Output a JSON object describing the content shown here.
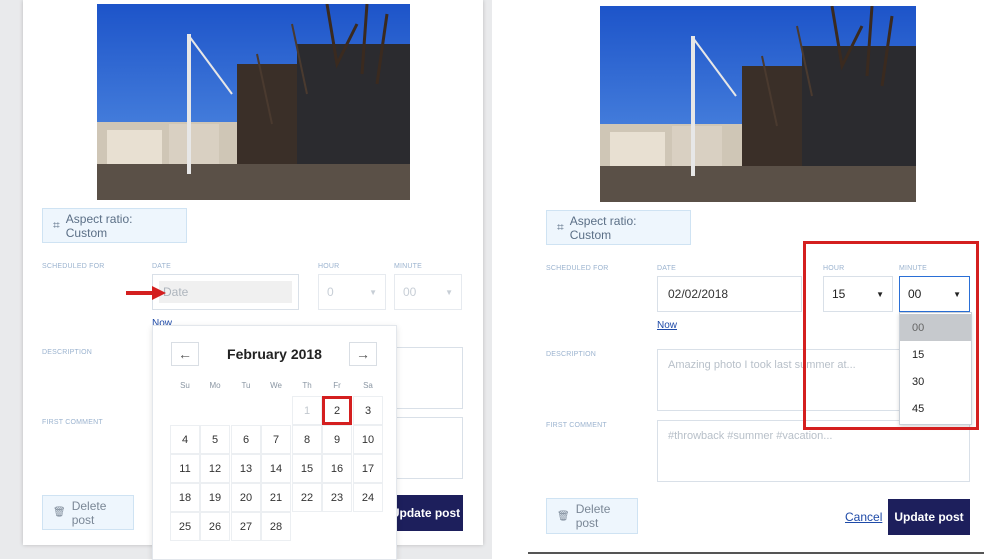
{
  "left": {
    "aspect_label": "Aspect ratio: Custom",
    "scheduled_for": "SCHEDULED FOR",
    "date_label": "DATE",
    "hour_label": "HOUR",
    "minute_label": "MINUTE",
    "date_placeholder": "Date",
    "hour_value": "0",
    "minute_value": "00",
    "now_link": "Now",
    "description_label": "DESCRIPTION",
    "first_comment_label": "FIRST COMMENT",
    "delete_label": "Delete post",
    "update_label": "Update post",
    "calendar": {
      "month": "February 2018",
      "prev": "←",
      "next": "→",
      "weekdays": [
        "Su",
        "Mo",
        "Tu",
        "We",
        "Th",
        "Fr",
        "Sa"
      ],
      "lead_days": [
        "1"
      ],
      "selected_day": "2",
      "day_3": "3",
      "week2": [
        "4",
        "5",
        "6",
        "7",
        "8",
        "9",
        "10"
      ],
      "week3": [
        "11",
        "12",
        "13",
        "14",
        "15",
        "16",
        "17"
      ],
      "week4": [
        "18",
        "19",
        "20",
        "21",
        "22",
        "23",
        "24"
      ],
      "week5": [
        "25",
        "26",
        "27",
        "28"
      ]
    }
  },
  "right": {
    "aspect_label": "Aspect ratio: Custom",
    "scheduled_for": "SCHEDULED FOR",
    "date_label": "DATE",
    "hour_label": "HOUR",
    "minute_label": "MINUTE",
    "date_value": "02/02/2018",
    "hour_value": "15",
    "minute_value": "00",
    "now_link": "Now",
    "description_label": "DESCRIPTION",
    "description_placeholder": "Amazing photo I took last summer at...",
    "first_comment_label": "FIRST COMMENT",
    "comment_placeholder": "#throwback #summer #vacation...",
    "minute_options": [
      "00",
      "15",
      "30",
      "45"
    ],
    "delete_label": "Delete post",
    "cancel_label": "Cancel",
    "update_label": "Update post"
  },
  "colors": {
    "accent": "#1d1f5c",
    "highlight": "#d41f1f",
    "link": "#1e4aa8"
  },
  "icons": [
    "crop-icon",
    "trash-icon",
    "chevron-down-icon",
    "red-arrow-icon"
  ]
}
